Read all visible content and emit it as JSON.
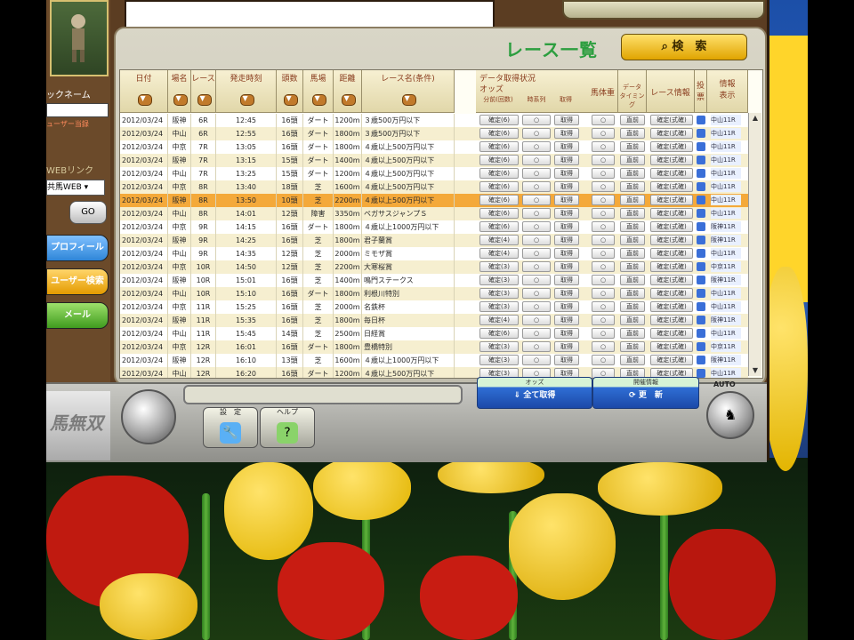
{
  "colors": {
    "accent_green": "#2c9e3f",
    "search_yellow": "#f0b800",
    "highlight_row": "#f4a93a",
    "row_alt": "#f6efd0"
  },
  "sidebar": {
    "nickname_label": "ックネーム",
    "subscription_label": "ューザー当録",
    "web_link_label": "WEBリンク",
    "web_select_value": "共馬WEB",
    "go_label": "GO",
    "profile_label": "プロフィール",
    "user_search_label": "ユーザー検索",
    "mail_label": "メール",
    "logo_text": "馬無双"
  },
  "panel": {
    "title": "レース一覧",
    "search_label": "検　索"
  },
  "columns": [
    "日付",
    "場名",
    "レース",
    "発走時刻",
    "頭数",
    "馬場",
    "距離",
    "レース名(条件)"
  ],
  "data_status": {
    "group_label": "データ取得状況",
    "odds_label": "オッズ",
    "sub_headers": [
      "分前(回数)",
      "時系列",
      "取得"
    ],
    "horse_weight": "馬体重",
    "data_timing": "データ\nタイミング",
    "race_info": "レース情報",
    "vote": "投票",
    "info_display": "情報\n表示"
  },
  "rows": [
    {
      "date": "2012/03/24",
      "venue": "阪神",
      "race": "6R",
      "time": "12:45",
      "count": "16頭",
      "track": "ダート",
      "dist": "1200m",
      "name": "３歳500万円以下",
      "odds": "確定(6)",
      "tl": "○",
      "get": "取得",
      "wt": "○",
      "tm": "直前",
      "info": "確定(式確)"
    },
    {
      "date": "2012/03/24",
      "venue": "中山",
      "race": "6R",
      "time": "12:55",
      "count": "16頭",
      "track": "ダート",
      "dist": "1800m",
      "name": "３歳500万円以下",
      "odds": "確定(6)",
      "tl": "○",
      "get": "取得",
      "wt": "○",
      "tm": "直前",
      "info": "確定(式確)"
    },
    {
      "date": "2012/03/24",
      "venue": "中京",
      "race": "7R",
      "time": "13:05",
      "count": "16頭",
      "track": "ダート",
      "dist": "1800m",
      "name": "４歳以上500万円以下",
      "odds": "確定(6)",
      "tl": "○",
      "get": "取得",
      "wt": "○",
      "tm": "直前",
      "info": "確定(式確)"
    },
    {
      "date": "2012/03/24",
      "venue": "阪神",
      "race": "7R",
      "time": "13:15",
      "count": "15頭",
      "track": "ダート",
      "dist": "1400m",
      "name": "４歳以上500万円以下",
      "odds": "確定(6)",
      "tl": "○",
      "get": "取得",
      "wt": "○",
      "tm": "直前",
      "info": "確定(式確)"
    },
    {
      "date": "2012/03/24",
      "venue": "中山",
      "race": "7R",
      "time": "13:25",
      "count": "15頭",
      "track": "ダート",
      "dist": "1200m",
      "name": "４歳以上500万円以下",
      "odds": "確定(6)",
      "tl": "○",
      "get": "取得",
      "wt": "○",
      "tm": "直前",
      "info": "確定(式確)"
    },
    {
      "date": "2012/03/24",
      "venue": "中京",
      "race": "8R",
      "time": "13:40",
      "count": "18頭",
      "track": "芝",
      "dist": "1600m",
      "name": "４歳以上500万円以下",
      "odds": "確定(6)",
      "tl": "○",
      "get": "取得",
      "wt": "○",
      "tm": "直前",
      "info": "確定(式確)"
    },
    {
      "date": "2012/03/24",
      "venue": "阪神",
      "race": "8R",
      "time": "13:50",
      "count": "10頭",
      "track": "芝",
      "dist": "2200m",
      "name": "４歳以上500万円以下",
      "odds": "確定(6)",
      "tl": "○",
      "get": "取得",
      "wt": "○",
      "tm": "直前",
      "info": "確定(式確)"
    },
    {
      "date": "2012/03/24",
      "venue": "中山",
      "race": "8R",
      "time": "14:01",
      "count": "12頭",
      "track": "障害",
      "dist": "3350m",
      "name": "ペガサスジャンプＳ",
      "odds": "確定(6)",
      "tl": "○",
      "get": "取得",
      "wt": "○",
      "tm": "直前",
      "info": "確定(式確)"
    },
    {
      "date": "2012/03/24",
      "venue": "中京",
      "race": "9R",
      "time": "14:15",
      "count": "16頭",
      "track": "ダート",
      "dist": "1800m",
      "name": "４歳以上1000万円以下",
      "odds": "確定(6)",
      "tl": "○",
      "get": "取得",
      "wt": "○",
      "tm": "直前",
      "info": "確定(式確)"
    },
    {
      "date": "2012/03/24",
      "venue": "阪神",
      "race": "9R",
      "time": "14:25",
      "count": "16頭",
      "track": "芝",
      "dist": "1800m",
      "name": "君子蘭賞",
      "odds": "確定(4)",
      "tl": "○",
      "get": "取得",
      "wt": "○",
      "tm": "直前",
      "info": "確定(式確)"
    },
    {
      "date": "2012/03/24",
      "venue": "中山",
      "race": "9R",
      "time": "14:35",
      "count": "12頭",
      "track": "芝",
      "dist": "2000m",
      "name": "ミモザ賞",
      "odds": "確定(4)",
      "tl": "○",
      "get": "取得",
      "wt": "○",
      "tm": "直前",
      "info": "確定(式確)"
    },
    {
      "date": "2012/03/24",
      "venue": "中京",
      "race": "10R",
      "time": "14:50",
      "count": "12頭",
      "track": "芝",
      "dist": "2200m",
      "name": "大寒桜賞",
      "odds": "確定(3)",
      "tl": "○",
      "get": "取得",
      "wt": "○",
      "tm": "直前",
      "info": "確定(式確)"
    },
    {
      "date": "2012/03/24",
      "venue": "阪神",
      "race": "10R",
      "time": "15:01",
      "count": "16頭",
      "track": "芝",
      "dist": "1400m",
      "name": "鳴門ステークス",
      "odds": "確定(3)",
      "tl": "○",
      "get": "取得",
      "wt": "○",
      "tm": "直前",
      "info": "確定(式確)"
    },
    {
      "date": "2012/03/24",
      "venue": "中山",
      "race": "10R",
      "time": "15:10",
      "count": "16頭",
      "track": "ダート",
      "dist": "1800m",
      "name": "利根川特別",
      "odds": "確定(3)",
      "tl": "○",
      "get": "取得",
      "wt": "○",
      "tm": "直前",
      "info": "確定(式確)"
    },
    {
      "date": "2012/03/24",
      "venue": "中京",
      "race": "11R",
      "time": "15:25",
      "count": "16頭",
      "track": "芝",
      "dist": "2000m",
      "name": "名鉄杯",
      "odds": "確定(3)",
      "tl": "○",
      "get": "取得",
      "wt": "○",
      "tm": "直前",
      "info": "確定(式確)"
    },
    {
      "date": "2012/03/24",
      "venue": "阪神",
      "race": "11R",
      "time": "15:35",
      "count": "16頭",
      "track": "芝",
      "dist": "1800m",
      "name": "毎日杯",
      "odds": "確定(4)",
      "tl": "○",
      "get": "取得",
      "wt": "○",
      "tm": "直前",
      "info": "確定(式確)"
    },
    {
      "date": "2012/03/24",
      "venue": "中山",
      "race": "11R",
      "time": "15:45",
      "count": "14頭",
      "track": "芝",
      "dist": "2500m",
      "name": "日経賞",
      "odds": "確定(6)",
      "tl": "○",
      "get": "取得",
      "wt": "○",
      "tm": "直前",
      "info": "確定(式確)"
    },
    {
      "date": "2012/03/24",
      "venue": "中京",
      "race": "12R",
      "time": "16:01",
      "count": "16頭",
      "track": "ダート",
      "dist": "1800m",
      "name": "豊橋特別",
      "odds": "確定(3)",
      "tl": "○",
      "get": "取得",
      "wt": "○",
      "tm": "直前",
      "info": "確定(式確)"
    },
    {
      "date": "2012/03/24",
      "venue": "阪神",
      "race": "12R",
      "time": "16:10",
      "count": "13頭",
      "track": "芝",
      "dist": "1600m",
      "name": "４歳以上1000万円以下",
      "odds": "確定(3)",
      "tl": "○",
      "get": "取得",
      "wt": "○",
      "tm": "直前",
      "info": "確定(式確)"
    },
    {
      "date": "2012/03/24",
      "venue": "中山",
      "race": "12R",
      "time": "16:20",
      "count": "16頭",
      "track": "ダート",
      "dist": "1200m",
      "name": "４歳以上500万円以下",
      "odds": "確定(3)",
      "tl": "○",
      "get": "取得",
      "wt": "○",
      "tm": "直前",
      "info": "確定(式確)"
    }
  ],
  "side_cells": [
    "中山11R",
    "中山11R",
    "中山11R",
    "中山11R",
    "中山11R",
    "中山11R",
    "中山11R",
    "中山11R",
    "阪神11R",
    "阪神11R",
    "中山11R",
    "中京11R",
    "阪神11R",
    "中山11R",
    "中山11R",
    "阪神11R",
    "中山11R",
    "中京11R",
    "阪神11R",
    "中山11R"
  ],
  "bottom": {
    "odds_group": "オッズ",
    "odds_button": "全て取得",
    "update_group": "開催情報",
    "update_button": "更　新",
    "auto_label": "AUTO",
    "settings_label": "設　定",
    "help_label": "ヘルプ"
  }
}
